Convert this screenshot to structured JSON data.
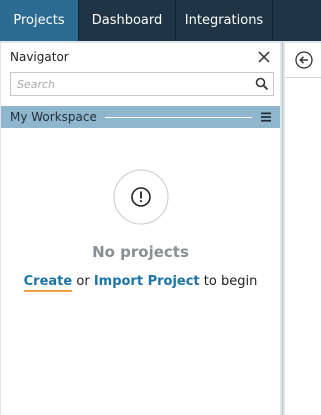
{
  "tabs": {
    "projects": "Projects",
    "dashboard": "Dashboard",
    "integrations": "Integrations"
  },
  "navigator": {
    "title": "Navigator",
    "search_placeholder": "Search",
    "workspace_title": "My Workspace"
  },
  "empty_state": {
    "title": "No projects",
    "create_link": "Create",
    "or_text": "or",
    "import_link": "Import Project",
    "suffix": "to begin"
  },
  "icons": {
    "close": "close-icon",
    "search": "search-icon",
    "menu": "menu-icon",
    "empty": "exclamation-circle-icon",
    "back": "arrow-left-circle-icon"
  },
  "colors": {
    "topbar": "#1f3545",
    "active_tab": "#2c6c93",
    "workspace_bar": "#8fb6cc",
    "link": "#1c74a6",
    "accent_underline": "#f0a040"
  }
}
